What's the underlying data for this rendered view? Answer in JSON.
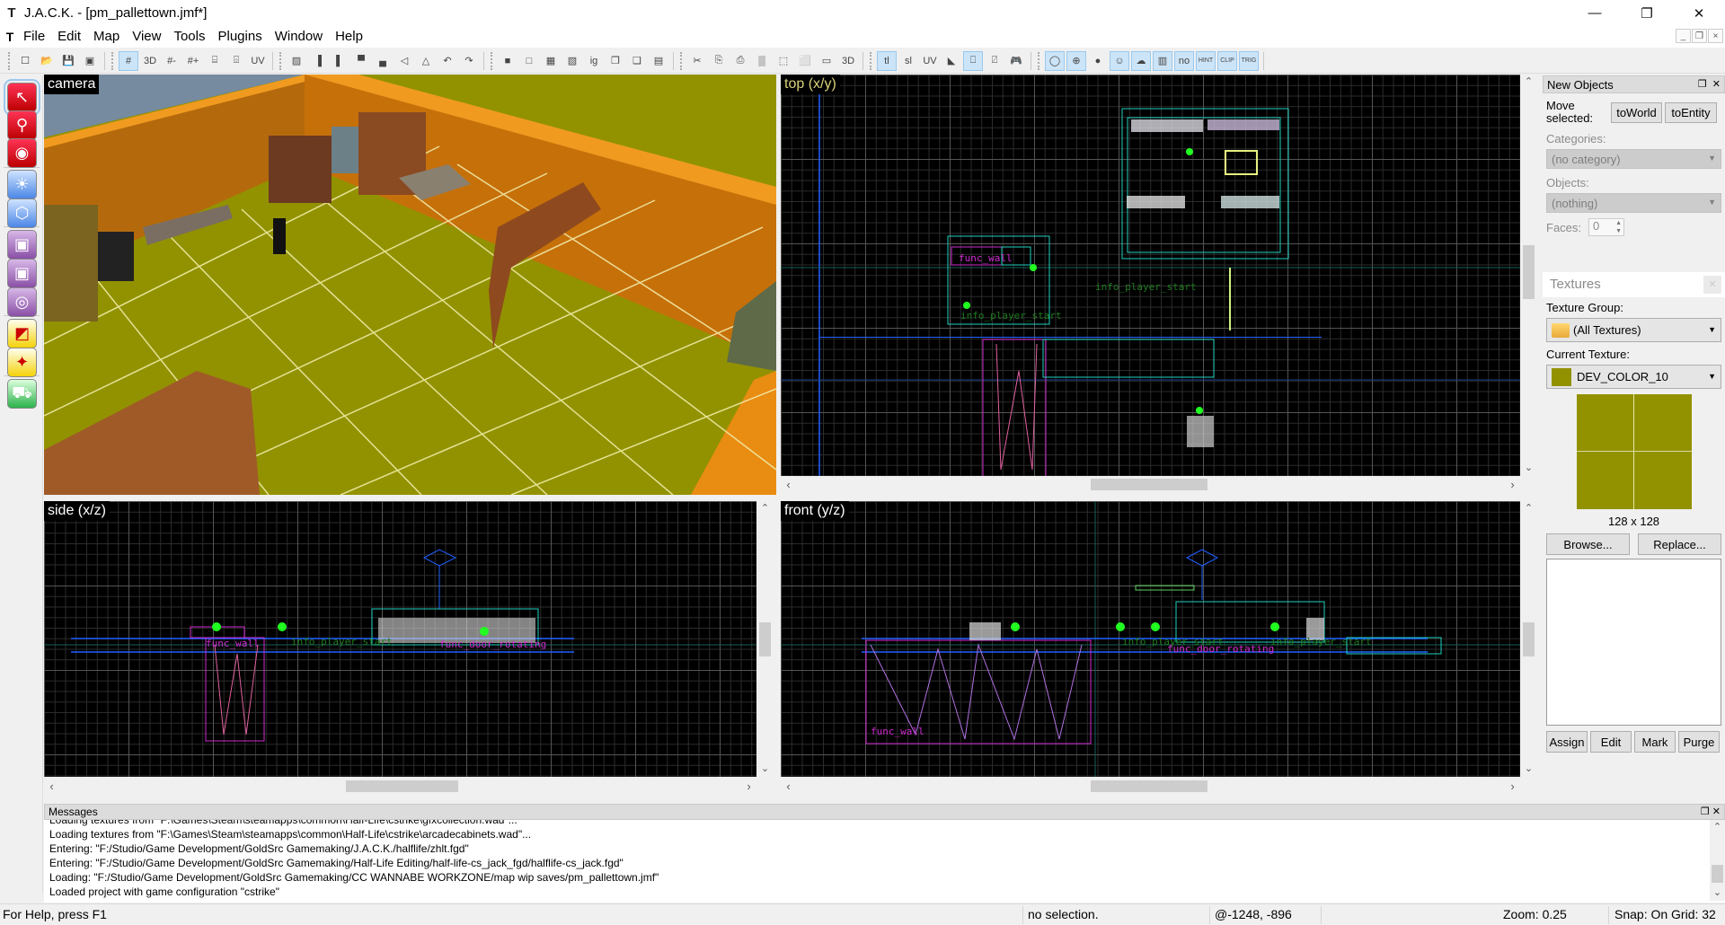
{
  "window": {
    "title": "J.A.C.K. - [pm_pallettown.jmf*]",
    "app_icon": "jack-t-icon",
    "controls": {
      "minimize": "—",
      "restore": "❐",
      "close": "✕"
    }
  },
  "menubar": {
    "items": [
      "File",
      "Edit",
      "Map",
      "View",
      "Tools",
      "Plugins",
      "Window",
      "Help"
    ],
    "mdi_controls": [
      "_",
      "❐",
      "×"
    ]
  },
  "toolbar": {
    "groups": [
      [
        {
          "name": "new",
          "glyph": "☐"
        },
        {
          "name": "open",
          "glyph": "📂"
        },
        {
          "name": "save",
          "glyph": "💾"
        },
        {
          "name": "save-as",
          "glyph": "▣"
        }
      ],
      [
        {
          "name": "grid",
          "glyph": "#",
          "on": true
        },
        {
          "name": "3d-grid",
          "glyph": "3D"
        },
        {
          "name": "smaller-grid",
          "glyph": "#-"
        },
        {
          "name": "larger-grid",
          "glyph": "#+"
        },
        {
          "name": "group",
          "glyph": "⌸"
        },
        {
          "name": "ungroup",
          "glyph": "⌹"
        },
        {
          "name": "uv-lock",
          "glyph": "UV"
        }
      ],
      [
        {
          "name": "carve",
          "glyph": "▨"
        },
        {
          "name": "align-left",
          "glyph": "▐"
        },
        {
          "name": "align-right",
          "glyph": "▌"
        },
        {
          "name": "align-top",
          "glyph": "▀"
        },
        {
          "name": "align-bottom",
          "glyph": "▄"
        },
        {
          "name": "flip-h",
          "glyph": "◁"
        },
        {
          "name": "flip-v",
          "glyph": "△"
        },
        {
          "name": "rotate-left",
          "glyph": "↶"
        },
        {
          "name": "rotate-right",
          "glyph": "↷"
        }
      ],
      [
        {
          "name": "hide",
          "glyph": "■"
        },
        {
          "name": "hide-unselected",
          "glyph": "□"
        },
        {
          "name": "show-all",
          "glyph": "▦"
        },
        {
          "name": "hide-entities",
          "glyph": "▧"
        },
        {
          "name": "ignore-groups",
          "glyph": "ig"
        },
        {
          "name": "tie-to-entity",
          "glyph": "❐"
        },
        {
          "name": "move-to-world",
          "glyph": "❑"
        },
        {
          "name": "hollow",
          "glyph": "▤"
        }
      ],
      [
        {
          "name": "cut",
          "glyph": "✂"
        },
        {
          "name": "copy",
          "glyph": "⎘"
        },
        {
          "name": "paste",
          "glyph": "⎙"
        },
        {
          "name": "texture-lock",
          "glyph": "▒"
        },
        {
          "name": "select-box",
          "glyph": "⬚"
        },
        {
          "name": "vertex-box",
          "glyph": "⬜"
        },
        {
          "name": "edge-box",
          "glyph": "▭"
        },
        {
          "name": "3d-box",
          "glyph": "3D"
        }
      ],
      [
        {
          "name": "tl",
          "glyph": "tl",
          "on": true
        },
        {
          "name": "sl",
          "glyph": "sl"
        },
        {
          "name": "lock",
          "glyph": "UV"
        },
        {
          "name": "paint",
          "glyph": "◣"
        },
        {
          "name": "poly-red",
          "glyph": "⎕",
          "on": true
        },
        {
          "name": "poly-green",
          "glyph": "⍁"
        },
        {
          "name": "run-game",
          "glyph": "🎮"
        }
      ],
      [
        {
          "name": "sphere",
          "glyph": "◯",
          "on": true
        },
        {
          "name": "cone",
          "glyph": "⊕",
          "on": true
        },
        {
          "name": "light",
          "glyph": "●"
        },
        {
          "name": "model",
          "glyph": "☺",
          "on": true
        },
        {
          "name": "skybox",
          "glyph": "☁",
          "on": true
        },
        {
          "name": "film",
          "glyph": "▥",
          "on": true
        },
        {
          "name": "nodraw",
          "glyph": "no",
          "on": true
        },
        {
          "name": "hint",
          "glyph": "HINT",
          "on": true
        },
        {
          "name": "clip",
          "glyph": "CLIP",
          "on": true
        },
        {
          "name": "trig",
          "glyph": "TRIG",
          "on": true
        }
      ]
    ]
  },
  "tools": [
    {
      "name": "selection-tool",
      "icon": "arrow-icon",
      "glyph": "↖",
      "color": "red",
      "selected": true
    },
    {
      "name": "magnify-tool",
      "icon": "magnifier-icon",
      "glyph": "⚲",
      "color": "red"
    },
    {
      "name": "camera-tool",
      "icon": "camera-icon",
      "glyph": "◉",
      "color": "red"
    },
    {
      "name": "entity-tool",
      "icon": "lightbulb-icon",
      "glyph": "☀",
      "color": "blue"
    },
    {
      "name": "block-tool",
      "icon": "wire-cube-icon",
      "glyph": "⬡",
      "color": "blue"
    },
    {
      "name": "texture-application-tool",
      "icon": "textured-cube-icon",
      "glyph": "▣",
      "color": "purple"
    },
    {
      "name": "apply-current-texture-tool",
      "icon": "green-cube-icon",
      "glyph": "▣",
      "color": "purple"
    },
    {
      "name": "decal-tool",
      "icon": "decal-cube-icon",
      "glyph": "◎",
      "color": "purple"
    },
    {
      "name": "clipping-tool",
      "icon": "clip-block-icon",
      "glyph": "◩",
      "color": "yellow"
    },
    {
      "name": "vertex-tool",
      "icon": "vertex-icon",
      "glyph": "✦",
      "color": "yellow"
    },
    {
      "name": "path-tool",
      "icon": "truck-icon",
      "glyph": "⛟",
      "color": "green"
    }
  ],
  "viewports": {
    "camera": {
      "label": "camera"
    },
    "top": {
      "label": "top (x/y)",
      "entities": [
        "func_wall",
        "info_player_start",
        "info_player_start"
      ]
    },
    "side": {
      "label": "side (x/z)",
      "entities": [
        "func_wall",
        "info_player_start",
        "func_door_rotating"
      ]
    },
    "front": {
      "label": "front (y/z)",
      "entities": [
        "func_wall",
        "info_player_start",
        "func_door_rotating",
        "info_player_start"
      ]
    }
  },
  "new_objects_panel": {
    "title": "New Objects",
    "move_selected_label": "Move selected:",
    "to_world": "toWorld",
    "to_entity": "toEntity",
    "categories_label": "Categories:",
    "categories_value": "(no category)",
    "objects_label": "Objects:",
    "objects_value": "(nothing)",
    "faces_label": "Faces:",
    "faces_value": "0"
  },
  "textures_panel": {
    "title": "Textures",
    "texture_group_label": "Texture Group:",
    "texture_group_value": "(All Textures)",
    "current_texture_label": "Current Texture:",
    "current_texture_value": "DEV_COLOR_10",
    "texture_color": "#929200",
    "texture_size": "128 x 128",
    "browse": "Browse...",
    "replace": "Replace...",
    "assign": "Assign",
    "edit": "Edit",
    "mark": "Mark",
    "purge": "Purge"
  },
  "messages": {
    "title": "Messages",
    "lines": [
      "Loading textures from \"F:\\Games\\Steam\\steamapps\\common\\Half-Life\\cstrike\\gfxcollection.wad\"...",
      "Loading textures from \"F:\\Games\\Steam\\steamapps\\common\\Half-Life\\cstrike\\arcadecabinets.wad\"...",
      "Entering: \"F:/Studio/Game Development/GoldSrc Gamemaking/J.A.C.K./halflife/zhlt.fgd\"",
      "Entering: \"F:/Studio/Game Development/GoldSrc Gamemaking/Half-Life Editing/half-life-cs_jack_fgd/halflife-cs_jack.fgd\"",
      "Loading: \"F:/Studio/Game Development/GoldSrc Gamemaking/CC WANNABE WORKZONE/map wip saves/pm_pallettown.jmf\"",
      "Loaded project with game configuration \"cstrike\""
    ]
  },
  "statusbar": {
    "help": "For Help, press F1",
    "selection": "no selection.",
    "coords": "@-1248, -896",
    "zoom": "Zoom: 0.25",
    "snap": "Snap: On Grid: 32"
  },
  "colors": {
    "wall_orange": "#d0790a",
    "floor_yellow": "#929200",
    "sky": "#768aa0",
    "entity_magenta": "#d02ad0",
    "entity_green": "#1e7a1e",
    "brush_cyan": "#1fd0c0",
    "axis_blue": "#2060ff"
  }
}
